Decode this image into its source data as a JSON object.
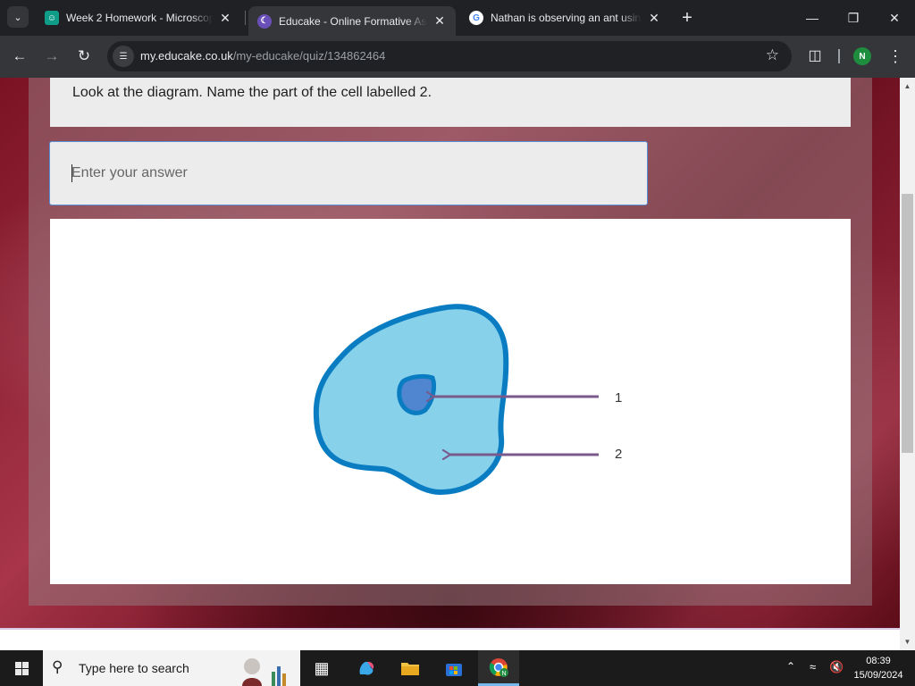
{
  "browser": {
    "tabs": [
      {
        "title": "Week 2 Homework - Microscop",
        "favicon": "teams-icon"
      },
      {
        "title": "Educake - Online Formative Ass",
        "favicon": "educake-icon",
        "active": true
      },
      {
        "title": "Nathan is observing an ant usin",
        "favicon": "google-icon"
      }
    ],
    "url_host": "my.educake.co.uk",
    "url_path": "/my-educake/quiz/134862464",
    "profile_initial": "N"
  },
  "quiz": {
    "question": "Look at the diagram. Name the part of the cell labelled 2.",
    "answer_placeholder": "Enter your answer",
    "answer_value": ""
  },
  "diagram": {
    "labels": [
      "1",
      "2"
    ],
    "colors": {
      "cytoplasm": "#87d1ea",
      "membrane": "#0a7dc2",
      "nucleus": "#4f86cf",
      "arrow": "#7a5a8c"
    }
  },
  "taskbar": {
    "search_placeholder": "Type here to search",
    "time": "08:39",
    "date": "15/09/2024"
  }
}
